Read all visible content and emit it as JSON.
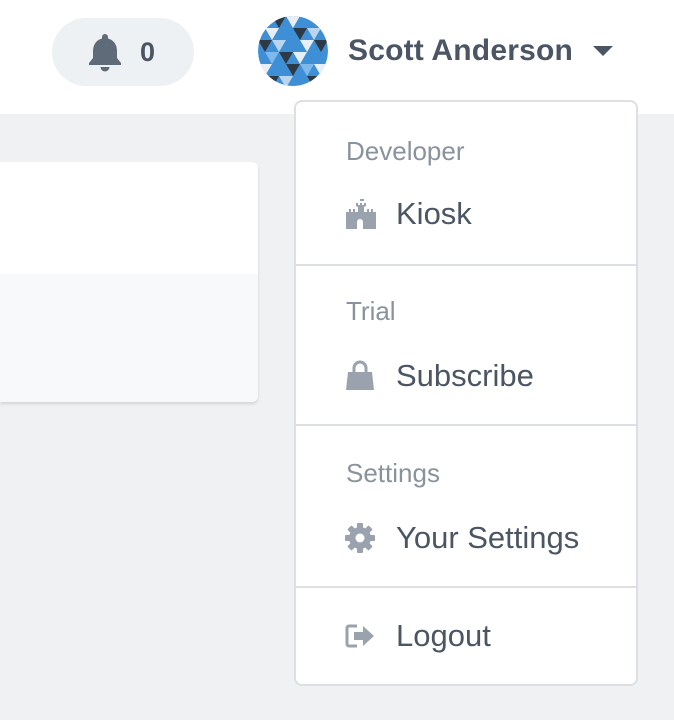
{
  "header": {
    "notifications": {
      "count": "0",
      "icon": "bell-icon"
    },
    "user": {
      "name": "Scott Anderson",
      "avatar": "avatar-triangles-pattern"
    }
  },
  "dropdown": {
    "sections": [
      {
        "header": "Developer",
        "items": [
          {
            "label": "Kiosk",
            "icon": "castle-icon"
          }
        ]
      },
      {
        "header": "Trial",
        "items": [
          {
            "label": "Subscribe",
            "icon": "shopping-bag-icon"
          }
        ]
      },
      {
        "header": "Settings",
        "items": [
          {
            "label": "Your Settings",
            "icon": "gear-icon"
          }
        ]
      },
      {
        "header": "",
        "items": [
          {
            "label": "Logout",
            "icon": "sign-out-icon"
          }
        ]
      }
    ]
  },
  "colors": {
    "text": "#4b5563",
    "muted": "#8a939c",
    "icon": "#9aa3ad",
    "background": "#eff1f3",
    "avatar_blue": "#3f8fd6",
    "avatar_dark": "#2d3a46"
  }
}
